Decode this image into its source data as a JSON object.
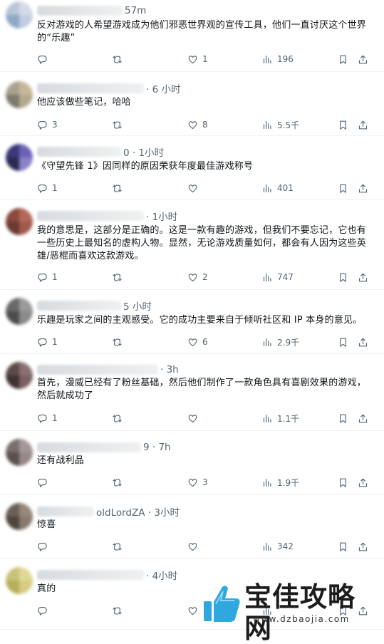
{
  "tweets": [
    {
      "time": "57m",
      "text": "反对游戏的人希望游戏成为他们邪恶世界观的宣传工具，他们一直讨厌这个世界的“乐趣”",
      "replies": "",
      "retweets": "",
      "likes": "1",
      "views": "196",
      "avatar": [
        "#b9c7d8",
        "#d4dbe6",
        "#8fa7c6",
        "#c2cde0"
      ]
    },
    {
      "time": "· 6 小时",
      "text": "他应该做些笔记，哈哈",
      "replies": "3",
      "retweets": "",
      "likes": "8",
      "views": "5.5千",
      "avatar": [
        "#a9a28e",
        "#c7b79a",
        "#7d7a6d",
        "#b5a88f"
      ]
    },
    {
      "time": "0 · 1小时",
      "text": "《守望先锋 1》因同样的原因荣获年度最佳游戏称号",
      "replies": "1",
      "retweets": "",
      "likes": "",
      "views": "401",
      "avatar": [
        "#3b3a7a",
        "#6a62b8",
        "#2a2a55",
        "#8b82c9"
      ]
    },
    {
      "time": "· 1小时",
      "text": "我的意思是，这部分是正确的。这是一款有趣的游戏，但我们不要忘记，它也有一些历史上最知名的虚构人物。显然，无论游戏质量如何，都会有人因为这些英雄/恶棍而喜欢这款游戏。",
      "replies": "1",
      "retweets": "",
      "likes": "2",
      "views": "747",
      "avatar": [
        "#8a4a3e",
        "#b3685a",
        "#6b3a33",
        "#a05a4d"
      ]
    },
    {
      "time": "5 小时",
      "text": "乐趣是玩家之间的主观感受。它的成功主要来自于倾听社区和 IP 本身的意见。",
      "replies": "1",
      "retweets": "",
      "likes": "6",
      "views": "2.9千",
      "avatar": [
        "#6a6a6a",
        "#9a9a9a",
        "#4d4d4d",
        "#8a8a8a"
      ]
    },
    {
      "time": "· 3h",
      "text": "首先，漫威已经有了粉丝基础，然后他们制作了一款角色具有喜剧效果的游戏，然后就成功了",
      "replies": "1",
      "retweets": "",
      "likes": "",
      "views": "1.1千",
      "avatar": [
        "#5d4a4a",
        "#8a7070",
        "#3f3232",
        "#7a6060"
      ]
    },
    {
      "time": "9 · 7h",
      "text": "还有战利品",
      "replies": "",
      "retweets": "",
      "likes": "3",
      "views": "1.9千",
      "avatar": [
        "#7a6d6d",
        "#a59797",
        "#5a5050",
        "#978888"
      ]
    },
    {
      "time": "oldLordZA · 3小时",
      "text": "惊喜",
      "replies": "",
      "retweets": "",
      "likes": "",
      "views": "342",
      "avatar": [
        "#6b5f55",
        "#95877a",
        "#4e453e",
        "#877a6e"
      ]
    },
    {
      "time": "· 4小时",
      "text": "真的",
      "replies": "",
      "retweets": "",
      "likes": "",
      "views": "",
      "avatar": [
        "#c9c27a",
        "#e0d896",
        "#b8ae5c",
        "#d6cc84"
      ]
    }
  ],
  "watermark": {
    "title": "宝佳攻略网",
    "url": "www.dzbaojia.com"
  },
  "icons": {
    "reply": "reply-icon",
    "retweet": "retweet-icon",
    "like": "heart-icon",
    "views": "views-icon",
    "bookmark": "bookmark-icon",
    "share": "share-icon"
  },
  "colors": {
    "text": "#0f1419",
    "muted": "#536471",
    "divider": "#eff3f4"
  }
}
